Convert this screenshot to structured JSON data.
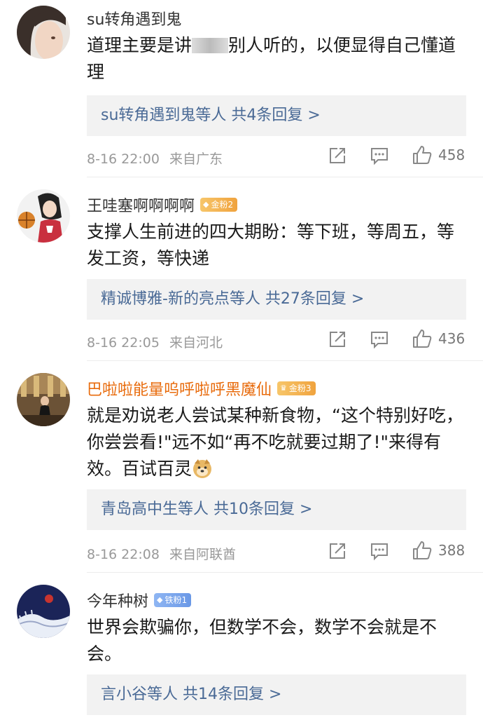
{
  "comments": [
    {
      "username": "su转角遇到鬼",
      "badge": "",
      "text_a": "道理主要是讲",
      "text_b": "别人听的，以便显得自己懂道理",
      "reply_summary": "su转角遇到鬼等人  共4条回复 >",
      "time": "8-16 22:00",
      "location": "来自广东",
      "likes": "458"
    },
    {
      "username": "王哇塞啊啊啊啊",
      "badge": "金粉2",
      "text": "支撑人生前进的四大期盼：等下班，等周五，等发工资，等快递",
      "reply_summary": "精诚博雅-新的亮点等人  共27条回复 >",
      "time": "8-16 22:05",
      "location": "来自河北",
      "likes": "436"
    },
    {
      "username": "巴啦啦能量呜呼啦呼黑魔仙",
      "badge": "金粉3",
      "text": "就是劝说老人尝试某种新食物，“这个特别好吃，你尝尝看!\"远不如“再不吃就要过期了!\"来得有效。百试百灵",
      "emoji": "doge-emoji",
      "reply_summary": "青岛高中生等人  共10条回复 >",
      "time": "8-16 22:08",
      "location": "来自阿联酋",
      "likes": "388"
    },
    {
      "username": "今年种树",
      "badge": "铁粉1",
      "text": "世界会欺骗你，但数学不会，数学不会就是不会。",
      "reply_summary": "言小谷等人  共14条回复 >"
    }
  ],
  "icons": {
    "share": "share-icon",
    "comment": "comment-icon",
    "like": "like-icon"
  },
  "colors": {
    "reply_link": "#4a6a96",
    "orange_name": "#e86b0c",
    "gold_badge": "#f0a33e",
    "iron_badge": "#6a98e6"
  }
}
